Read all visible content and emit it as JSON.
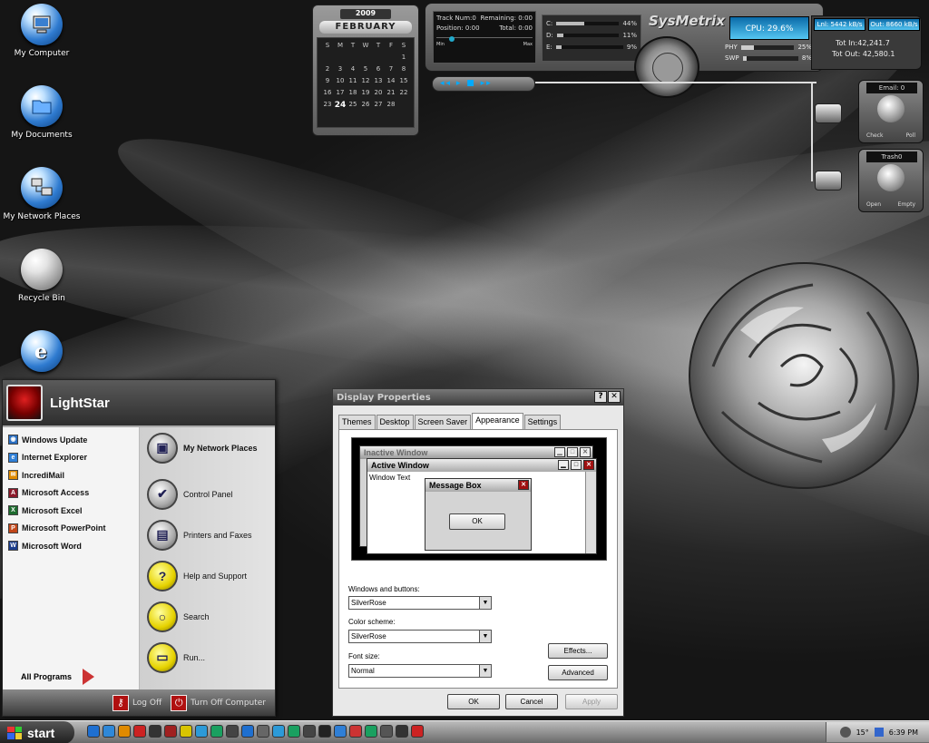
{
  "desktop": {
    "icons": [
      {
        "label": "My Computer"
      },
      {
        "label": "My Documents"
      },
      {
        "label": "My Network Places"
      },
      {
        "label": "Recycle Bin"
      },
      {
        "label": ""
      }
    ]
  },
  "calendar": {
    "year": "2009",
    "month": "FEBRUARY",
    "weekdays": [
      "S",
      "M",
      "T",
      "W",
      "T",
      "F",
      "S"
    ],
    "days": [
      "",
      "",
      "",
      "",
      "",
      "",
      "1",
      "2",
      "3",
      "4",
      "5",
      "6",
      "7",
      "8",
      "9",
      "10",
      "11",
      "12",
      "13",
      "14",
      "15",
      "16",
      "17",
      "18",
      "19",
      "20",
      "21",
      "22",
      "23",
      "24",
      "25",
      "26",
      "27",
      "28"
    ],
    "today": "24"
  },
  "sysmetrix": {
    "name": "SysMetrix",
    "track": "Track Num:0",
    "remaining": "Remaining: 0:00",
    "position": "Position: 0:00",
    "total": "Total:",
    "total_value": "0:00",
    "min_label": "Min",
    "max_label": "Max",
    "drives": [
      {
        "label": "C:",
        "pct": "44%",
        "fill": 0.44
      },
      {
        "label": "D:",
        "pct": "11%",
        "fill": 0.11
      },
      {
        "label": "E:",
        "pct": "9%",
        "fill": 0.09
      }
    ],
    "cpu": "CPU: 29.6%",
    "phy_label": "PHY",
    "phy_pct": "25%",
    "phy_fill": 0.25,
    "swp_label": "SWP",
    "swp_pct": "8%",
    "swp_fill": 0.08,
    "net_in": "Lnl: 5442 kB/s",
    "net_out": "Out: 8660 kB/s",
    "tot_in": "Tot In:42,241.7",
    "tot_out": "Tot Out: 42,580.1",
    "play_controls": "◂◂ ▸ ■ ▸▸"
  },
  "email_widget": {
    "title": "Email: 0",
    "left": "Check",
    "right": "Poll"
  },
  "trash_widget": {
    "title": "Trash0",
    "left": "Open",
    "right": "Empty"
  },
  "start_menu": {
    "user": "LightStar",
    "left_items": [
      {
        "label": "Windows Update",
        "color": "#2a6fc2",
        "glyph": "◉"
      },
      {
        "label": "Internet Explorer",
        "color": "#2f7fd6",
        "glyph": "e"
      },
      {
        "label": "IncrediMail",
        "color": "#e08a00",
        "glyph": "✉"
      },
      {
        "label": "Microsoft Access",
        "color": "#8b1a2a",
        "glyph": "A"
      },
      {
        "label": "Microsoft Excel",
        "color": "#1d6b2e",
        "glyph": "X"
      },
      {
        "label": "Microsoft PowerPoint",
        "color": "#c2471a",
        "glyph": "P"
      },
      {
        "label": "Microsoft Word",
        "color": "#1b3d8c",
        "glyph": "W"
      }
    ],
    "all_programs": "All Programs",
    "right_items": [
      {
        "label": "My Network Places",
        "glyph": "▣",
        "bold": true
      },
      {
        "label": "Control Panel",
        "glyph": "✔"
      },
      {
        "label": "Printers and Faxes",
        "glyph": "▤"
      },
      {
        "label": "Help and Support",
        "glyph": "?"
      },
      {
        "label": "Search",
        "glyph": "○"
      },
      {
        "label": "Run...",
        "glyph": "▭"
      }
    ],
    "log_off": "Log Off",
    "turn_off": "Turn Off Computer"
  },
  "display_properties": {
    "title": "Display Properties",
    "tabs": [
      "Themes",
      "Desktop",
      "Screen Saver",
      "Appearance",
      "Settings"
    ],
    "active_tab": "Appearance",
    "preview": {
      "inactive": "Inactive Window",
      "active": "Active Window",
      "window_text": "Window Text",
      "message_box": "Message Box",
      "ok": "OK"
    },
    "windows_buttons_label": "Windows and buttons:",
    "windows_buttons_value": "SilverRose",
    "color_scheme_label": "Color scheme:",
    "color_scheme_value": "SilverRose",
    "font_size_label": "Font size:",
    "font_size_value": "Normal",
    "effects": "Effects...",
    "advanced": "Advanced",
    "ok": "OK",
    "cancel": "Cancel",
    "apply": "Apply"
  },
  "taskbar": {
    "start": "start",
    "temperature": "15°",
    "time": "6:39 PM",
    "quicklaunch_colors": [
      "#1e6fd0",
      "#2f88d8",
      "#e08a00",
      "#c22",
      "#333",
      "#a02020",
      "#d8c400",
      "#2c9ad8",
      "#1aa060",
      "#444",
      "#1e6fd0",
      "#666",
      "#2c9ad8",
      "#1aa060",
      "#444",
      "#222",
      "#2f7fd6",
      "#c33",
      "#1aa060",
      "#555",
      "#333",
      "#c22"
    ]
  }
}
